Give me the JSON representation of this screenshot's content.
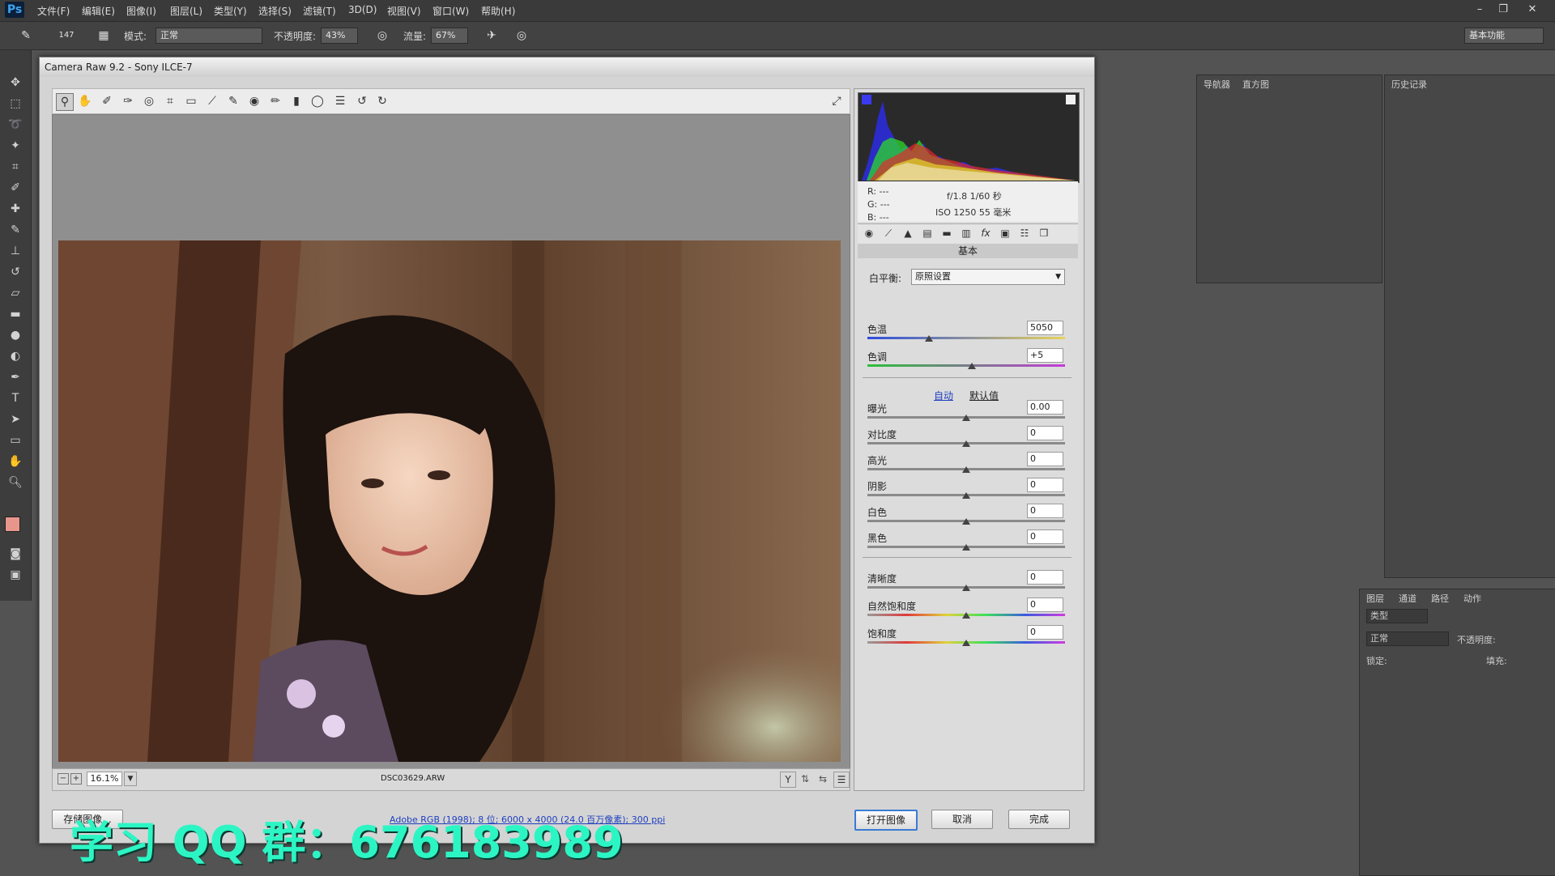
{
  "menubar": {
    "logo": "Ps",
    "items": [
      "文件(F)",
      "编辑(E)",
      "图像(I)",
      "图层(L)",
      "类型(Y)",
      "选择(S)",
      "滤镜(T)",
      "3D(D)",
      "视图(V)",
      "窗口(W)",
      "帮助(H)"
    ]
  },
  "optbar": {
    "brush_size": "147",
    "mode_label": "模式:",
    "mode_value": "正常",
    "opacity_label": "不透明度:",
    "opacity_value": "43%",
    "flow_label": "流量:",
    "flow_value": "67%",
    "workspace": "基本功能"
  },
  "dialog": {
    "title": "Camera Raw 9.2 - Sony ILCE-7",
    "zoom": "16.1%",
    "filename": "DSC03629.ARW",
    "save_button": "存储图像...",
    "info_link": "Adobe RGB (1998); 8 位; 6000 x 4000 (24.0 百万像素); 300 ppi",
    "open_button": "打开图像",
    "cancel_button": "取消",
    "done_button": "完成"
  },
  "readout": {
    "r": "R:  ---",
    "g": "G:  ---",
    "b": "B:  ---",
    "exposure": "f/1.8   1/60 秒",
    "iso": "ISO 1250   55 毫米"
  },
  "basic": {
    "panel_title": "基本",
    "wb_label": "白平衡:",
    "wb_value": "原照设置",
    "auto": "自动",
    "default": "默认值",
    "sliders": [
      {
        "label": "色温",
        "value": "5050",
        "pos": 0.31
      },
      {
        "label": "色调",
        "value": "+5",
        "pos": 0.53
      },
      {
        "label": "曝光",
        "value": "0.00",
        "pos": 0.5
      },
      {
        "label": "对比度",
        "value": "0",
        "pos": 0.5
      },
      {
        "label": "高光",
        "value": "0",
        "pos": 0.5
      },
      {
        "label": "阴影",
        "value": "0",
        "pos": 0.5
      },
      {
        "label": "白色",
        "value": "0",
        "pos": 0.5
      },
      {
        "label": "黑色",
        "value": "0",
        "pos": 0.5
      },
      {
        "label": "清晰度",
        "value": "0",
        "pos": 0.5
      },
      {
        "label": "自然饱和度",
        "value": "0",
        "pos": 0.5
      },
      {
        "label": "饱和度",
        "value": "0",
        "pos": 0.5
      }
    ]
  },
  "docks": {
    "navigator": "导航器",
    "histogram": "直方图",
    "history": "历史记录",
    "layers": "图层",
    "channels": "通道",
    "paths": "路径",
    "actions": "动作",
    "kind": "类型",
    "blend": "正常",
    "opacity": "不透明度:",
    "lock": "锁定:",
    "fill": "填充:"
  },
  "watermark": "学习 QQ 群：676183989",
  "colors": {
    "accent": "#2cf5c4",
    "brand": "#3fa3f0"
  }
}
